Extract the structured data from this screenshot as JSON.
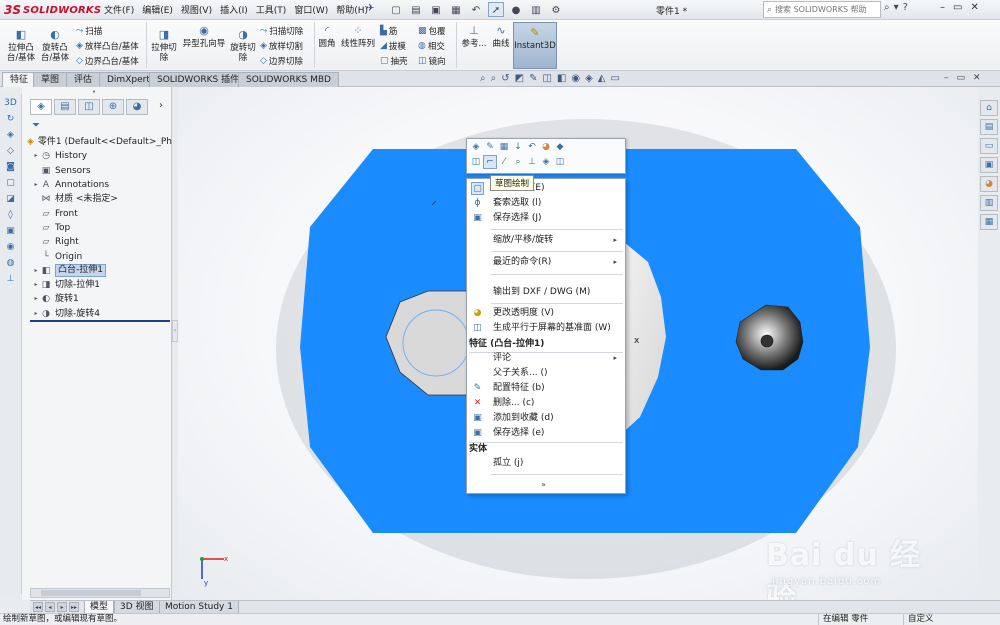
{
  "app": {
    "logo_text": "SOLIDWORKS",
    "document_title": "零件1 *",
    "search_placeholder": "搜索 SOLIDWORKS 帮助"
  },
  "menu": [
    "文件(F)",
    "编辑(E)",
    "视图(V)",
    "插入(I)",
    "工具(T)",
    "窗口(W)",
    "帮助(H)"
  ],
  "commands": {
    "extrude_boss": "拉伸凸\n台/基体",
    "revolve_boss": "旋转凸\n台/基体",
    "sweep": "扫描",
    "loft": "放样凸台/基体",
    "boundary": "边界凸台/基体",
    "extrude_cut": "拉伸切\n除",
    "hole_wizard": "异型孔向导",
    "revolve_cut": "旋转切\n除",
    "sweep_cut": "扫描切除",
    "loft_cut": "放样切割",
    "boundary_cut": "边界切除",
    "fillet": "圆角",
    "linear_pattern": "线性阵列",
    "rib": "筋",
    "wrap": "包覆",
    "draft": "拔模",
    "intersect": "相交",
    "shell": "抽壳",
    "mirror": "镜向",
    "reference": "参考...",
    "curves": "曲线",
    "instant3d": "Instant3D"
  },
  "tabs": [
    "特征",
    "草图",
    "评估",
    "DimXpert",
    "SOLIDWORKS 插件",
    "SOLIDWORKS MBD"
  ],
  "tree": {
    "root": "零件1  (Default<<Default>_Ph",
    "items": [
      "History",
      "Sensors",
      "Annotations",
      "材质 <未指定>",
      "Front",
      "Top",
      "Right",
      "Origin",
      "凸台-拉伸1",
      "切除-拉伸1",
      "旋转1",
      "切除-旋转4"
    ]
  },
  "tooltip": "草图绘制",
  "context_menu": {
    "item_sketch": "草图绘制 (E)",
    "item_lasso": "套索选取 (l)",
    "item_save_sel": "保存选择 (J)",
    "item_zoom": "缩放/平移/旋转",
    "item_recent": "最近的命令(R)",
    "item_dxf": "输出到 DXF / DWG (M)",
    "item_transparency": "更改透明度 (V)",
    "item_parallel_plane": "生成平行于屏幕的基准面 (W)",
    "header_feature": "特征 (凸台-拉伸1)",
    "item_comment": "评论",
    "item_parent_child": "父子关系... ()",
    "item_config": "配置特征 (b)",
    "item_delete": "删除... (c)",
    "item_favorites": "添加到收藏 (d)",
    "item_save_sel2": "保存选择 (e)",
    "header_body": "实体",
    "item_isolate": "孤立 (j)",
    "expand": "»"
  },
  "viewport": {
    "cursor_mark": "x",
    "triad_x": "x",
    "triad_y": "y",
    "part_color": "#1a8cff"
  },
  "bottom_tabs": [
    "模型",
    "3D 视图",
    "Motion Study 1"
  ],
  "status": {
    "left": "绘制新草图，或编辑现有草图。",
    "mid": "在编辑 零件",
    "right": "自定义"
  },
  "watermark": {
    "text": "Bai du 经验",
    "url": "jingyan.baidu.com"
  },
  "icons": {
    "search": "search-icon",
    "pin": "pin-icon",
    "filter": "filter-icon"
  }
}
